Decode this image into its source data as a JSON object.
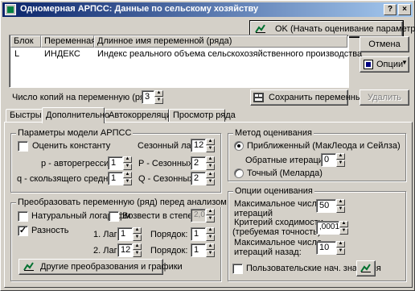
{
  "window": {
    "title": "Одномерная АРПСС: Данные по сельскому хозяйству",
    "controls": [
      "?",
      "×"
    ]
  },
  "ok_button": "OK (Начать оценивание параметров)",
  "cancel_button": "Отмена",
  "options_button": "Опции",
  "variables_table": {
    "columns": [
      "Блок",
      "Переменная",
      "Длинное имя переменной (ряда)"
    ],
    "rows": [
      {
        "block": "L",
        "variable": "ИНДЕКС",
        "long_name": "Индекс реального объема сельскохозяйственного производства"
      }
    ]
  },
  "copies": {
    "label": "Число копий на переменную (ряд):",
    "value": "3"
  },
  "save_vars_button": "Сохранить переменные",
  "delete_button": "Удалить",
  "tabs": [
    "Быстрый",
    "Дополнительно",
    "Автокорреляции",
    "Просмотр ряда"
  ],
  "active_tab": "Дополнительно",
  "arima_params": {
    "legend": "Параметры модели АРПСС",
    "estimate_constant": {
      "label": "Оценить константу",
      "checked": false
    },
    "seasonal_lag": {
      "label": "Сезонный лаг:",
      "value": "12"
    },
    "p": {
      "label": "p - авторегрессии:",
      "value": "1"
    },
    "P": {
      "label": "P - Сезонных:",
      "value": "2"
    },
    "q": {
      "label": "q - скользящего среднего:",
      "value": "1"
    },
    "Q": {
      "label": "Q - Сезонных:",
      "value": "2"
    }
  },
  "transform": {
    "legend": "Преобразовать переменную (ряд) перед анализом",
    "natural_log": {
      "label": "Натуральный логарифм",
      "checked": false
    },
    "power": {
      "label": "Возвести в степень:",
      "checked": false,
      "value": "2,0"
    },
    "difference": {
      "label": "Разность",
      "checked": true
    },
    "lag1": {
      "label": "1. Лаг:",
      "value": "1",
      "order_label": "Порядок:",
      "order": "1"
    },
    "lag2": {
      "label": "2. Лаг:",
      "value": "12",
      "order_label": "Порядок:",
      "order": "1"
    },
    "other_button": "Другие преобразования и графики"
  },
  "method": {
    "legend": "Метод оценивания",
    "approx": {
      "label": "Приближенный (МакЛеода и Сейлза)",
      "selected": true
    },
    "backcasts": {
      "label": "Обратные итерации:",
      "value": "0"
    },
    "exact": {
      "label": "Точный (Меларда)",
      "selected": false
    }
  },
  "estimation_options": {
    "legend": "Опции оценивания",
    "max_iter": {
      "label1": "Максимальное число",
      "label2": "итераций",
      "value": "50"
    },
    "convergence": {
      "label1": "Критерий сходимости",
      "label2": "(требуемая точность):",
      "value": ",0001"
    },
    "max_back_iter": {
      "label1": "Максимальное число",
      "label2": "итераций назад:",
      "value": "10"
    },
    "user_initial": {
      "label": "Пользовательские нач. значения",
      "checked": false
    }
  },
  "colors": {
    "title_start": "#0a246a",
    "title_end": "#a6caf0",
    "face": "#d4d0c8"
  },
  "icons": [
    "app-icon",
    "run-icon",
    "options-icon",
    "save-icon",
    "graph-icon"
  ]
}
